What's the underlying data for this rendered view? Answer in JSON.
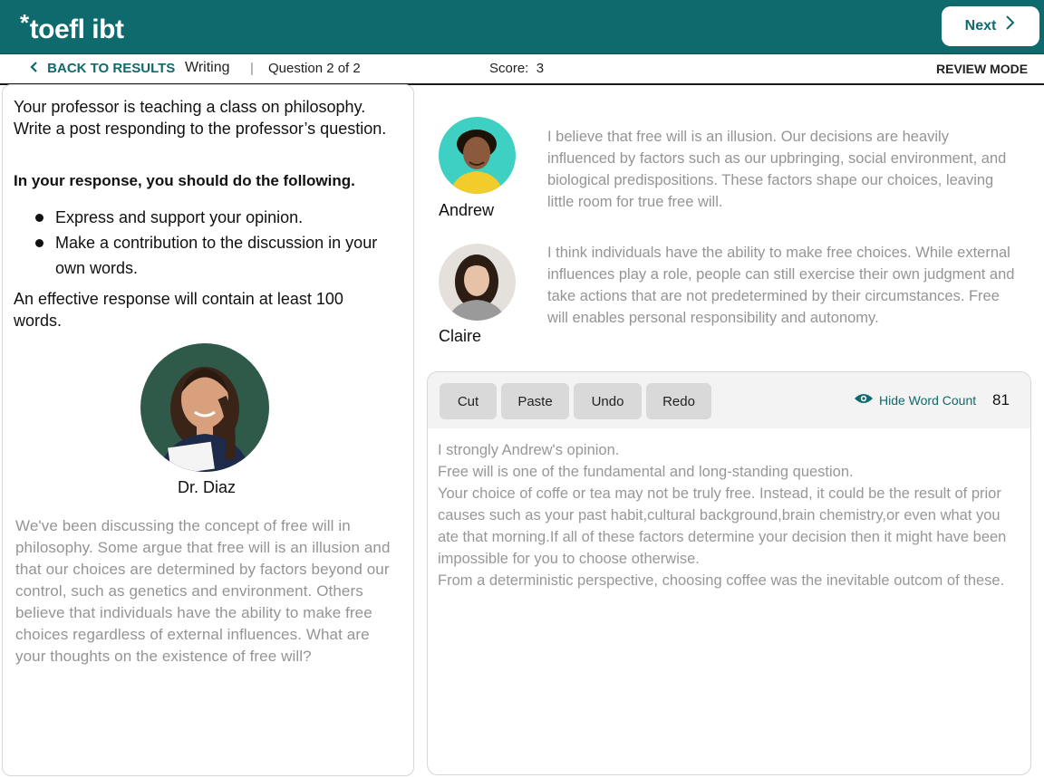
{
  "header": {
    "logo_text": "toefl ibt",
    "logo_symbol": "*",
    "next_label": "Next",
    "next_icon": "chevron-right-icon",
    "brand_color": "#0e6a6c"
  },
  "subbar": {
    "back_label": "BACK TO RESULTS",
    "back_icon": "chevron-left-icon",
    "section": "Writing",
    "divider": "|",
    "question": "Question 2 of 2",
    "score_label": "Score:",
    "score_value": "3",
    "mode": "REVIEW MODE"
  },
  "prompt": {
    "intro": "Your professor is teaching a class on philosophy. Write a post responding to the professor’s question.",
    "instructions_heading": "In your response, you should do the following.",
    "bullets": [
      "Express and support your opinion.",
      "Make a contribution to the discussion in your own words."
    ],
    "min_words": "An effective response will contain at least 100 words."
  },
  "professor": {
    "name": "Dr.  Diaz",
    "question": "We've been discussing the concept of free will in philosophy.  Some argue that free will is an illusion and that our choices are determined by factors beyond our control, such as genetics and environment.  Others believe that individuals have the ability to make free choices regardless of external influences.  What are your thoughts on the existence of free will?"
  },
  "students": [
    {
      "name": "Andrew",
      "post": "I believe that free will is an illusion.  Our decisions are heavily influenced by factors such as our upbringing, social environment, and biological predispositions.  These factors shape our choices, leaving little room for true free will."
    },
    {
      "name": "Claire",
      "post": "I think individuals have the ability to make free choices.  While external influences play a role, people can still exercise their own judgment and take actions that are not predetermined by their circumstances.  Free will enables personal responsibility and autonomy."
    }
  ],
  "editor": {
    "buttons": {
      "cut": "Cut",
      "paste": "Paste",
      "undo": "Undo",
      "redo": "Redo"
    },
    "hide_word_count": "Hide Word Count",
    "word_count": "81",
    "essay_lines": [
      "I strongly Andrew's opinion.",
      "Free will is one of the fundamental and long-standing question.",
      "Your choice of coffe or tea may not be truly free. Instead, it could be the result of prior causes such as your past habit,cultural background,brain chemistry,or even what you ate that morning.If all of these factors determine your decision then it might have been impossible for you to choose otherwise.",
      "From a deterministic perspective, choosing coffee was the inevitable outcom of these."
    ]
  }
}
